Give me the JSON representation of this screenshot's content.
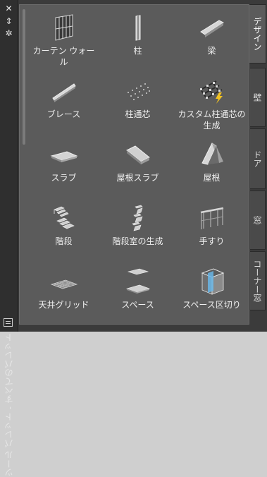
{
  "window": {
    "title": "ツール パレット - すべてのパレット",
    "close_glyph": "✕",
    "pin_glyph": "⇕",
    "settings_glyph": "✲"
  },
  "tools": [
    {
      "label": "カーテン ウォール",
      "icon": "curtain-wall-icon"
    },
    {
      "label": "柱",
      "icon": "column-icon"
    },
    {
      "label": "梁",
      "icon": "beam-icon"
    },
    {
      "label": "ブレース",
      "icon": "brace-icon"
    },
    {
      "label": "柱通芯",
      "icon": "column-grid-icon"
    },
    {
      "label": "カスタム柱通芯の生成",
      "icon": "custom-column-grid-icon"
    },
    {
      "label": "スラブ",
      "icon": "slab-icon"
    },
    {
      "label": "屋根スラブ",
      "icon": "roof-slab-icon"
    },
    {
      "label": "屋根",
      "icon": "roof-icon"
    },
    {
      "label": "階段",
      "icon": "stair-icon"
    },
    {
      "label": "階段室の生成",
      "icon": "stair-tower-icon"
    },
    {
      "label": "手すり",
      "icon": "railing-icon"
    },
    {
      "label": "天井グリッド",
      "icon": "ceiling-grid-icon"
    },
    {
      "label": "スペース",
      "icon": "space-icon"
    },
    {
      "label": "スペース区切り",
      "icon": "space-separator-icon"
    }
  ],
  "tabs": [
    {
      "label": "デザイン",
      "active": true
    },
    {
      "label": "壁",
      "active": false
    },
    {
      "label": "ドア",
      "active": false
    },
    {
      "label": "窓",
      "active": false
    },
    {
      "label": "コーナー窓",
      "active": false
    }
  ]
}
